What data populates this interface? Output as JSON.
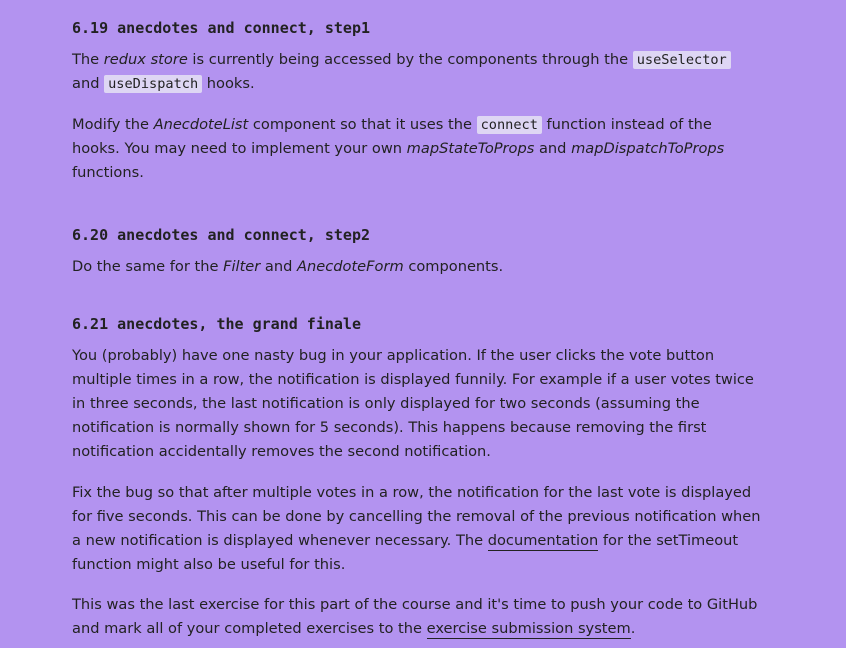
{
  "section_1": {
    "title": "6.19 anecdotes and connect, step1",
    "p1": {
      "t1": "The ",
      "em1": "redux store",
      "t2": " is currently being accessed by the components through the ",
      "code1": "useSelector",
      "t3": " and ",
      "code2": "useDispatch",
      "t4": " hooks."
    },
    "p2": {
      "t1": "Modify the ",
      "em1": "AnecdoteList",
      "t2": " component so that it uses the ",
      "code1": "connect",
      "t3": " function instead of the hooks. You may need to implement your own ",
      "em2": "mapStateToProps",
      "t4": " and ",
      "em3": "mapDispatchToProps",
      "t5": " functions."
    }
  },
  "section_2": {
    "title": "6.20 anecdotes and connect, step2",
    "p1": {
      "t1": "Do the same for the ",
      "em1": "Filter",
      "t2": " and ",
      "em2": "AnecdoteForm",
      "t3": " components."
    }
  },
  "section_3": {
    "title": "6.21 anecdotes, the grand finale",
    "p1": "You (probably) have one nasty bug in your application. If the user clicks the vote button multiple times in a row, the notification is displayed funnily. For example if a user votes twice in three seconds, the last notification is only displayed for two seconds (assuming the notification is normally shown for 5 seconds). This happens because removing the first notification accidentally removes the second notification.",
    "p2": {
      "t1": "Fix the bug so that after multiple votes in a row, the notification for the last vote is displayed for five seconds. This can be done by cancelling the removal of the previous notification when a new notification is displayed whenever necessary. The ",
      "link1": "documentation",
      "t2": " for the setTimeout function might also be useful for this."
    },
    "p3": {
      "t1": "This was the last exercise for this part of the course and it's time to push your code to GitHub and mark all of your completed exercises to the ",
      "link1": "exercise submission system",
      "t2": "."
    }
  },
  "colors": {
    "background": "#b393f0",
    "code_background": "#ded6f4",
    "text": "#222222"
  }
}
